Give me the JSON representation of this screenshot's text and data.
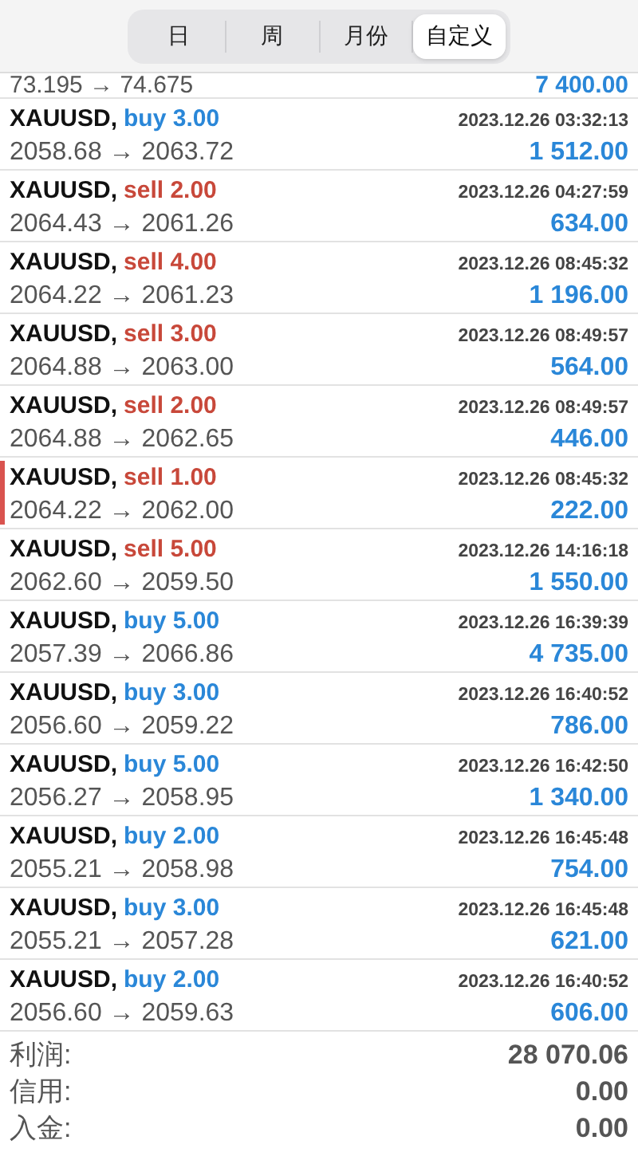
{
  "tabs": [
    {
      "label": "日",
      "selected": false
    },
    {
      "label": "周",
      "selected": false
    },
    {
      "label": "月份",
      "selected": false
    },
    {
      "label": "自定义",
      "selected": true
    }
  ],
  "partial_row": {
    "prices": "73.195 → 74.675",
    "profit": "7 400.00"
  },
  "trades": [
    {
      "symbol": "XAUUSD,",
      "kind": "buy",
      "volume": "buy 3.00",
      "time": "2023.12.26 03:32:13",
      "prices": "2058.68 → 2063.72",
      "profit": "1 512.00",
      "highlighted": false
    },
    {
      "symbol": "XAUUSD,",
      "kind": "sell",
      "volume": "sell 2.00",
      "time": "2023.12.26 04:27:59",
      "prices": "2064.43 → 2061.26",
      "profit": "634.00",
      "highlighted": false
    },
    {
      "symbol": "XAUUSD,",
      "kind": "sell",
      "volume": "sell 4.00",
      "time": "2023.12.26 08:45:32",
      "prices": "2064.22 → 2061.23",
      "profit": "1 196.00",
      "highlighted": false
    },
    {
      "symbol": "XAUUSD,",
      "kind": "sell",
      "volume": "sell 3.00",
      "time": "2023.12.26 08:49:57",
      "prices": "2064.88 → 2063.00",
      "profit": "564.00",
      "highlighted": false
    },
    {
      "symbol": "XAUUSD,",
      "kind": "sell",
      "volume": "sell 2.00",
      "time": "2023.12.26 08:49:57",
      "prices": "2064.88 → 2062.65",
      "profit": "446.00",
      "highlighted": false
    },
    {
      "symbol": "XAUUSD,",
      "kind": "sell",
      "volume": "sell 1.00",
      "time": "2023.12.26 08:45:32",
      "prices": "2064.22 → 2062.00",
      "profit": "222.00",
      "highlighted": true
    },
    {
      "symbol": "XAUUSD,",
      "kind": "sell",
      "volume": "sell 5.00",
      "time": "2023.12.26 14:16:18",
      "prices": "2062.60 → 2059.50",
      "profit": "1 550.00",
      "highlighted": false
    },
    {
      "symbol": "XAUUSD,",
      "kind": "buy",
      "volume": "buy 5.00",
      "time": "2023.12.26 16:39:39",
      "prices": "2057.39 → 2066.86",
      "profit": "4 735.00",
      "highlighted": false
    },
    {
      "symbol": "XAUUSD,",
      "kind": "buy",
      "volume": "buy 3.00",
      "time": "2023.12.26 16:40:52",
      "prices": "2056.60 → 2059.22",
      "profit": "786.00",
      "highlighted": false
    },
    {
      "symbol": "XAUUSD,",
      "kind": "buy",
      "volume": "buy 5.00",
      "time": "2023.12.26 16:42:50",
      "prices": "2056.27 → 2058.95",
      "profit": "1 340.00",
      "highlighted": false
    },
    {
      "symbol": "XAUUSD,",
      "kind": "buy",
      "volume": "buy 2.00",
      "time": "2023.12.26 16:45:48",
      "prices": "2055.21 → 2058.98",
      "profit": "754.00",
      "highlighted": false
    },
    {
      "symbol": "XAUUSD,",
      "kind": "buy",
      "volume": "buy 3.00",
      "time": "2023.12.26 16:45:48",
      "prices": "2055.21 → 2057.28",
      "profit": "621.00",
      "highlighted": false
    },
    {
      "symbol": "XAUUSD,",
      "kind": "buy",
      "volume": "buy 2.00",
      "time": "2023.12.26 16:40:52",
      "prices": "2056.60 → 2059.63",
      "profit": "606.00",
      "highlighted": false
    }
  ],
  "summary": [
    {
      "label": "利润:",
      "value": "28 070.06"
    },
    {
      "label": "信用:",
      "value": "0.00"
    },
    {
      "label": "入金:",
      "value": "0.00"
    }
  ]
}
